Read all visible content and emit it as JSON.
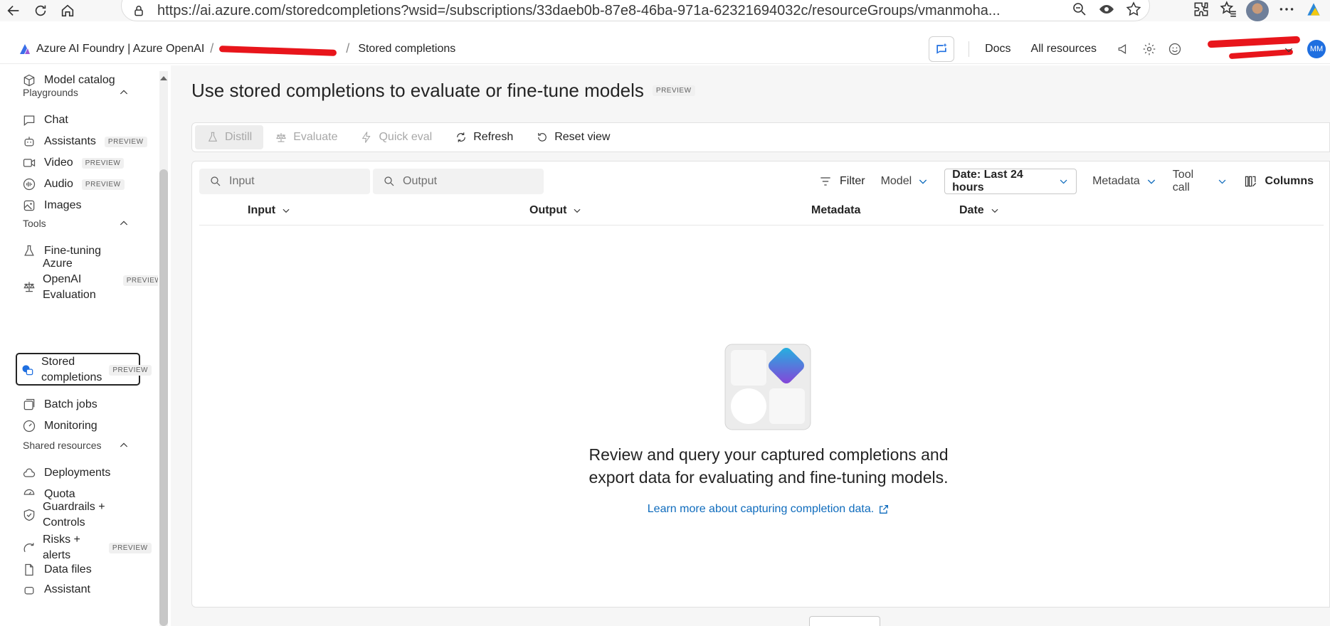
{
  "browser": {
    "url": "https://ai.azure.com/storedcompletions?wsid=/subscriptions/33daeb0b-87e8-46ba-971a-62321694032c/resourceGroups/vmanmoha..."
  },
  "header": {
    "brand": "Azure AI Foundry | Azure OpenAI",
    "breadcrumb_current": "Stored completions",
    "docs": "Docs",
    "all_resources": "All resources",
    "user_initials": "MM"
  },
  "sidebar": {
    "model_catalog": "Model catalog",
    "sections": {
      "playgrounds": "Playgrounds",
      "tools": "Tools",
      "shared": "Shared resources"
    },
    "items": {
      "chat": "Chat",
      "assistants": "Assistants",
      "video": "Video",
      "audio": "Audio",
      "images": "Images",
      "fine_tuning": "Fine-tuning",
      "evaluation_1": "Azure",
      "evaluation_2": "OpenAI",
      "evaluation_3": "Evaluation",
      "stored_1": "Stored",
      "stored_2": "completions",
      "batch": "Batch jobs",
      "monitoring": "Monitoring",
      "deployments": "Deployments",
      "quota": "Quota",
      "guardrails_1": "Guardrails +",
      "guardrails_2": "Controls",
      "risks_1": "Risks +",
      "risks_2": "alerts",
      "data_files": "Data files",
      "assistant": "Assistant"
    },
    "badge": "PREVIEW"
  },
  "main": {
    "title": "Use stored completions to evaluate or fine-tune models",
    "title_badge": "PREVIEW",
    "toolbar": {
      "distill": "Distill",
      "evaluate": "Evaluate",
      "quick_eval": "Quick eval",
      "refresh": "Refresh",
      "reset_view": "Reset view"
    },
    "search": {
      "input_placeholder": "Input",
      "output_placeholder": "Output"
    },
    "filters": {
      "filter": "Filter",
      "model": "Model",
      "date": "Date: Last 24 hours",
      "metadata": "Metadata",
      "tool_call": "Tool call",
      "columns": "Columns"
    },
    "columns": {
      "input": "Input",
      "output": "Output",
      "metadata": "Metadata",
      "date": "Date"
    },
    "empty": {
      "line1": "Review and query your captured completions and",
      "line2": "export data for evaluating and fine-tuning models.",
      "link": "Learn more about capturing completion data."
    }
  },
  "colors": {
    "accent": "#0f6cbd",
    "redaction": "#e8151b"
  }
}
